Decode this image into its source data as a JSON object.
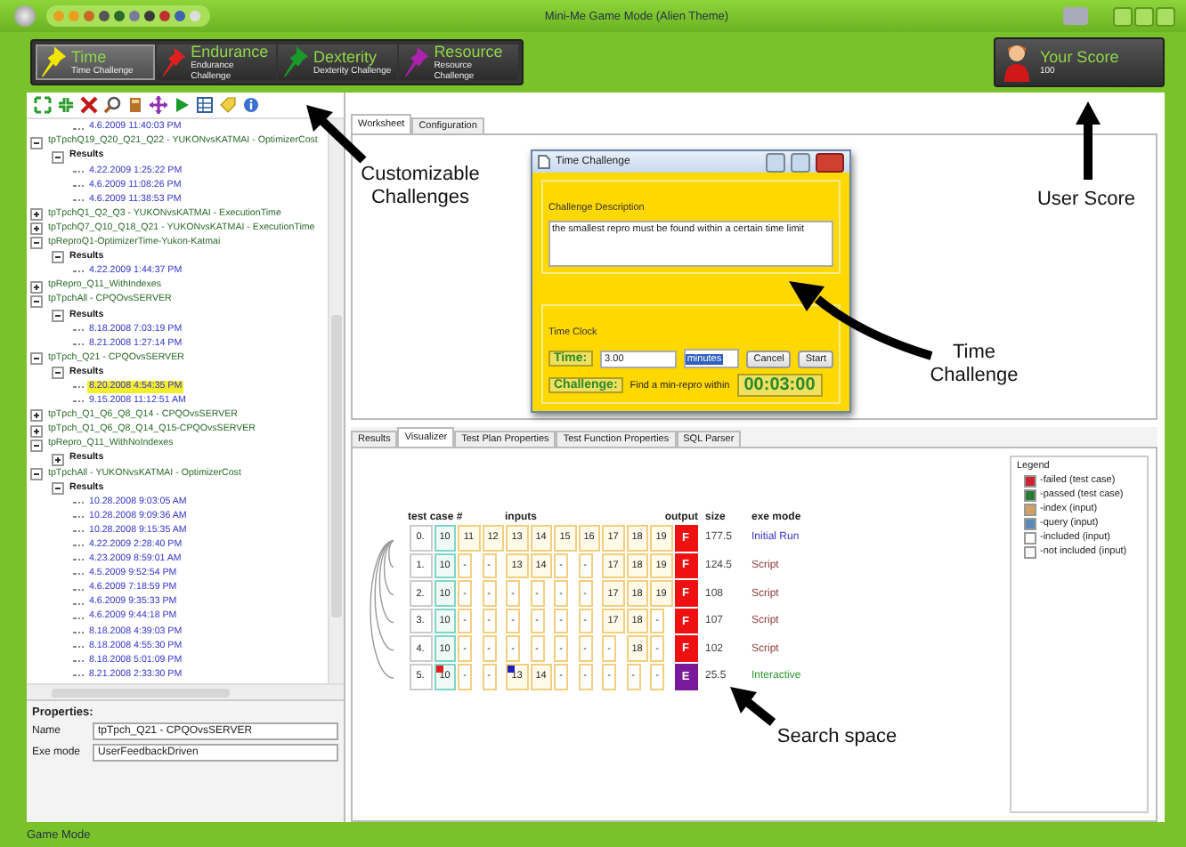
{
  "window": {
    "title": "Mini-Me Game Mode (Alien Theme)"
  },
  "challenges": [
    {
      "title": "Time",
      "subtitle": "Time Challenge",
      "color": "#f2e600",
      "selected": true
    },
    {
      "title": "Endurance",
      "subtitle": "Endurance Challenge",
      "color": "#e02020",
      "selected": false
    },
    {
      "title": "Dexterity",
      "subtitle": "Dexterity Challenge",
      "color": "#1a9a2a",
      "selected": false
    },
    {
      "title": "Resource",
      "subtitle": "Resource Challenge",
      "color": "#b020b0",
      "selected": false
    }
  ],
  "score": {
    "title": "Your Score",
    "value": "100"
  },
  "tree": [
    {
      "kind": "run",
      "label": "4.6.2009 11:40:03 PM",
      "selected": false
    },
    {
      "kind": "test",
      "label": "tpTpchQ19_Q20_Q21_Q22 - YUKONvsKATMAI - OptimizerCost",
      "expanded": true,
      "children": [
        {
          "kind": "results",
          "label": "Results",
          "expanded": true,
          "children": [
            {
              "kind": "run",
              "label": "4.22.2009 1:25:22 PM",
              "selected": false
            },
            {
              "kind": "run",
              "label": "4.6.2009 11:08:26 PM",
              "selected": false
            },
            {
              "kind": "run",
              "label": "4.6.2009 11:38:53 PM",
              "selected": false
            }
          ]
        }
      ]
    },
    {
      "kind": "test",
      "label": "tpTpchQ1_Q2_Q3 - YUKONvsKATMAI - ExecutionTime",
      "expanded": false
    },
    {
      "kind": "test",
      "label": "tpTpchQ7_Q10_Q18_Q21 - YUKONvsKATMAI - ExecutionTime",
      "expanded": false
    },
    {
      "kind": "test",
      "label": "tpReproQ1-OptimizerTime-Yukon-Katmai",
      "expanded": true,
      "children": [
        {
          "kind": "results",
          "label": "Results",
          "expanded": true,
          "children": [
            {
              "kind": "run",
              "label": "4.22.2009 1:44:37 PM",
              "selected": false
            }
          ]
        }
      ]
    },
    {
      "kind": "test",
      "label": "tpRepro_Q11_WithIndexes",
      "expanded": false
    },
    {
      "kind": "test",
      "label": "tpTpchAll - CPQOvsSERVER",
      "expanded": true,
      "children": [
        {
          "kind": "results",
          "label": "Results",
          "expanded": true,
          "children": [
            {
              "kind": "run",
              "label": "8.18.2008 7:03:19 PM",
              "selected": false
            },
            {
              "kind": "run",
              "label": "8.21.2008 1:27:14 PM",
              "selected": false
            }
          ]
        }
      ]
    },
    {
      "kind": "test",
      "label": "tpTpch_Q21 - CPQOvsSERVER",
      "expanded": true,
      "children": [
        {
          "kind": "results",
          "label": "Results",
          "expanded": true,
          "children": [
            {
              "kind": "run",
              "label": "8.20.2008 4:54:35 PM",
              "selected": true
            },
            {
              "kind": "run",
              "label": "9.15.2008 11:12:51 AM",
              "selected": false
            }
          ]
        }
      ]
    },
    {
      "kind": "test",
      "label": "tpTpch_Q1_Q6_Q8_Q14 - CPQOvsSERVER",
      "expanded": false
    },
    {
      "kind": "test",
      "label": "tpTpch_Q1_Q6_Q8_Q14_Q15-CPQOvsSERVER",
      "expanded": false
    },
    {
      "kind": "test",
      "label": "tpRepro_Q11_WithNoIndexes",
      "expanded": true,
      "children": [
        {
          "kind": "results",
          "label": "Results",
          "expanded": false
        }
      ]
    },
    {
      "kind": "test",
      "label": "tpTpchAll - YUKONvsKATMAI - OptimizerCost",
      "expanded": true,
      "children": [
        {
          "kind": "results",
          "label": "Results",
          "expanded": true,
          "children": [
            {
              "kind": "run",
              "label": "10.28.2008 9:03:05 AM",
              "selected": false
            },
            {
              "kind": "run",
              "label": "10.28.2008 9:09:36 AM",
              "selected": false
            },
            {
              "kind": "run",
              "label": "10.28.2008 9:15:35 AM",
              "selected": false
            },
            {
              "kind": "run",
              "label": "4.22.2009 2:28:40 PM",
              "selected": false
            },
            {
              "kind": "run",
              "label": "4.23.2009 8:59:01 AM",
              "selected": false
            },
            {
              "kind": "run",
              "label": "4.5.2009 9:52:54 PM",
              "selected": false
            },
            {
              "kind": "run",
              "label": "4.6.2009 7:18:59 PM",
              "selected": false
            },
            {
              "kind": "run",
              "label": "4.6.2009 9:35:33 PM",
              "selected": false
            },
            {
              "kind": "run",
              "label": "4.6.2009 9:44:18 PM",
              "selected": false
            },
            {
              "kind": "run",
              "label": "8.18.2008 4:39:03 PM",
              "selected": false
            },
            {
              "kind": "run",
              "label": "8.18.2008 4:55:30 PM",
              "selected": false
            },
            {
              "kind": "run",
              "label": "8.18.2008 5:01:09 PM",
              "selected": false
            },
            {
              "kind": "run",
              "label": "8.21.2008 2:33:30 PM",
              "selected": false
            }
          ]
        }
      ]
    }
  ],
  "properties": {
    "heading": "Properties:",
    "fields": [
      {
        "label": "Name",
        "value": "tpTpch_Q21 - CPQOvsSERVER"
      },
      {
        "label": "Exe mode",
        "value": "UserFeedbackDriven"
      }
    ]
  },
  "top_tabs": [
    {
      "label": "Worksheet",
      "selected": true
    },
    {
      "label": "Configuration",
      "selected": false
    }
  ],
  "dialog": {
    "title": "Time Challenge",
    "description_label": "Challenge Description",
    "description": "the smallest repro must be found within a certain time limit",
    "clock_label": "Time Clock",
    "time_label": "Time:",
    "time_value": "3.00",
    "unit": "minutes",
    "buttons": [
      "Cancel",
      "Start"
    ],
    "challenge_label": "Challenge:",
    "challenge_text": "Find a min-repro within",
    "timer": "00:03:00"
  },
  "bottom_tabs": [
    {
      "label": "Results",
      "selected": false
    },
    {
      "label": "Visualizer",
      "selected": true
    },
    {
      "label": "Test Plan Properties",
      "selected": false
    },
    {
      "label": "Test Function Properties",
      "selected": false
    },
    {
      "label": "SQL Parser",
      "selected": false
    }
  ],
  "visualizer": {
    "headers": {
      "case": "test case #",
      "inputs": "inputs",
      "output": "output",
      "size": "size",
      "mode": "exe mode"
    },
    "rows": [
      {
        "case": "0.",
        "inputs": [
          "10",
          "11",
          "12",
          "13",
          "14",
          "15",
          "16",
          "17",
          "18",
          "19"
        ],
        "output": {
          "text": "F",
          "color": "#ee1111"
        },
        "size": "177.5",
        "mode": {
          "text": "Initial Run",
          "kind": "initial"
        }
      },
      {
        "case": "1.",
        "inputs": [
          "10",
          "-",
          "-",
          "13",
          "14",
          "-",
          "-",
          "17",
          "18",
          "19"
        ],
        "output": {
          "text": "F",
          "color": "#ee1111"
        },
        "size": "124.5",
        "mode": {
          "text": "Script",
          "kind": "script"
        }
      },
      {
        "case": "2.",
        "inputs": [
          "10",
          "-",
          "-",
          "-",
          "-",
          "-",
          "-",
          "17",
          "18",
          "19"
        ],
        "output": {
          "text": "F",
          "color": "#ee1111"
        },
        "size": "108",
        "mode": {
          "text": "Script",
          "kind": "script"
        }
      },
      {
        "case": "3.",
        "inputs": [
          "10",
          "-",
          "-",
          "-",
          "-",
          "-",
          "-",
          "17",
          "18",
          "-"
        ],
        "output": {
          "text": "F",
          "color": "#ee1111"
        },
        "size": "107",
        "mode": {
          "text": "Script",
          "kind": "script"
        }
      },
      {
        "case": "4.",
        "inputs": [
          "10",
          "-",
          "-",
          "-",
          "-",
          "-",
          "-",
          "-",
          "18",
          "-"
        ],
        "output": {
          "text": "F",
          "color": "#ee1111"
        },
        "size": "102",
        "mode": {
          "text": "Script",
          "kind": "script"
        }
      },
      {
        "case": "5.",
        "inputs": [
          "10",
          "-",
          "-",
          "13",
          "14",
          "-",
          "-",
          "-",
          "-",
          "-"
        ],
        "output": {
          "text": "E",
          "color": "#7a1a9a"
        },
        "size": "25.5",
        "mode": {
          "text": "Interactive",
          "kind": "interactive"
        },
        "markers": [
          {
            "kind": "first-input",
            "color": "#e02020"
          },
          {
            "kind": "fourth-input",
            "color": "#2020c0"
          }
        ]
      }
    ]
  },
  "legend": {
    "title": "Legend",
    "items": [
      {
        "label": "-failed (test case)",
        "color": "#cc2233"
      },
      {
        "label": "-passed (test case)",
        "color": "#2a7a3a"
      },
      {
        "label": "-index (input)",
        "color": "#d4a060"
      },
      {
        "label": "-query (input)",
        "color": "#5a8ab8"
      },
      {
        "label": "-included (input)",
        "color": "#ffffff"
      },
      {
        "label": "-not included (input)",
        "color": "#fafafa"
      }
    ]
  },
  "callouts": [
    {
      "kind": "challenges",
      "text": "Customizable Challenges"
    },
    {
      "kind": "score",
      "text": "User Score"
    },
    {
      "kind": "time",
      "text": "Time Challenge"
    },
    {
      "kind": "search",
      "text": "Search space"
    }
  ],
  "status_bar": {
    "text": "Game Mode"
  }
}
